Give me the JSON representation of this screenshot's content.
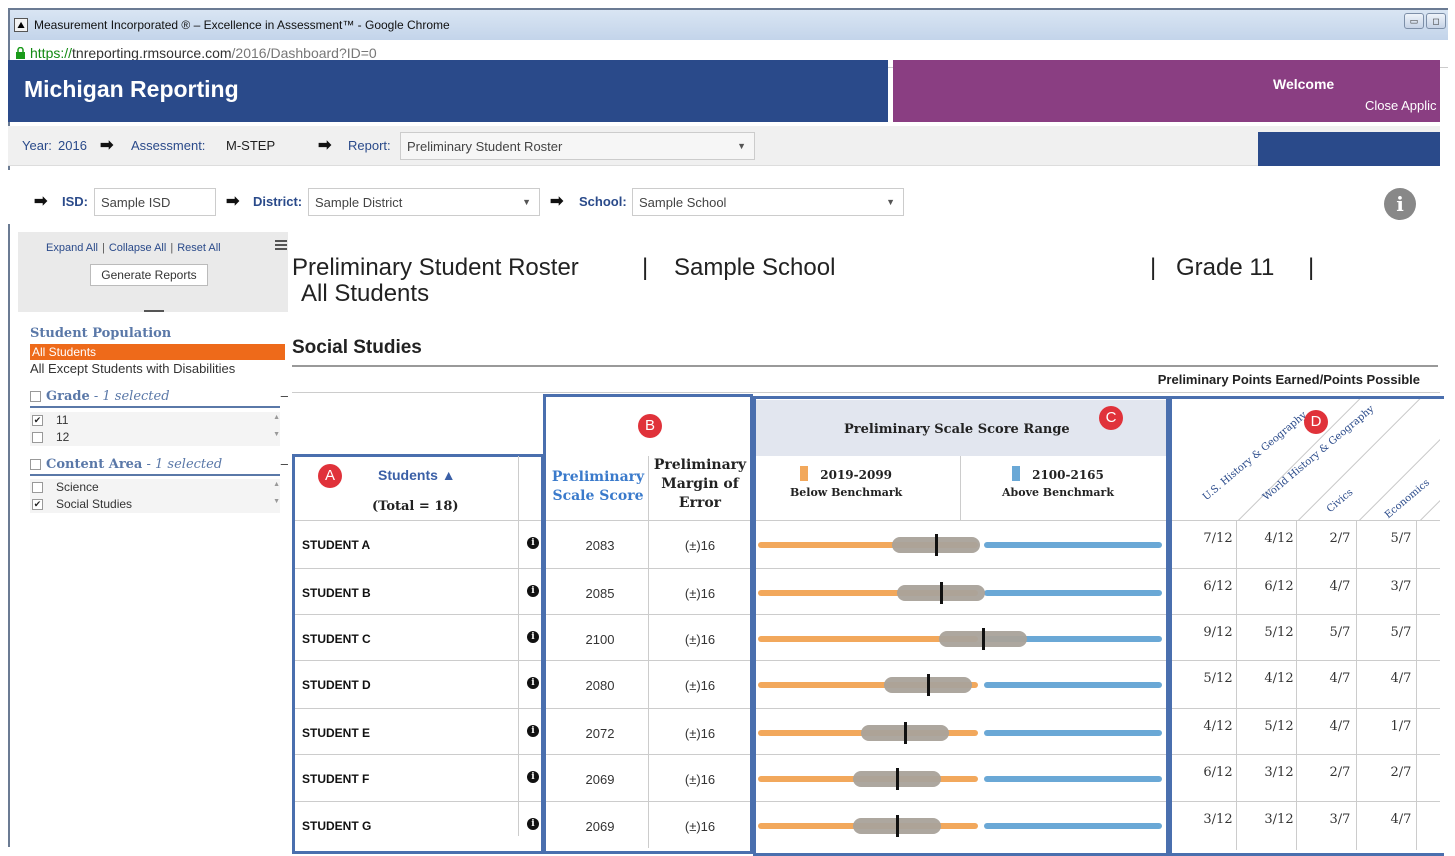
{
  "browser": {
    "window_title": "Measurement Incorporated ® – Excellence in Assessment™ - Google Chrome",
    "url_https": "https://",
    "url_host": "tnreporting.rmsource.com",
    "url_path": "/2016/Dashboard?ID=0"
  },
  "app": {
    "title": "Michigan Reporting",
    "welcome": "Welcome",
    "close_label": "Close Applic"
  },
  "filters": {
    "year_label": "Year:",
    "year_value": "2016",
    "assessment_label": "Assessment:",
    "assessment_value": "M-STEP",
    "report_label": "Report:",
    "report_value": "Preliminary Student Roster",
    "isd_label": "ISD:",
    "isd_value": "Sample ISD",
    "district_label": "District:",
    "district_value": "Sample District",
    "school_label": "School:",
    "school_value": "Sample School"
  },
  "sidebar": {
    "expand_all": "Expand All",
    "collapse_all": "Collapse All",
    "reset_all": "Reset All",
    "generate_reports": "Generate Reports",
    "population_title": "Student Population",
    "population_selected": "All Students",
    "population_other": "All Except Students with Disabilities",
    "grade_title": "Grade",
    "grade_selected": " - 1 selected",
    "grade_options": [
      "11",
      "12"
    ],
    "content_title": "Content Area",
    "content_selected": " - 1 selected",
    "content_options": [
      "Science",
      "Social Studies"
    ]
  },
  "main": {
    "title": "Preliminary Student Roster",
    "separator": "|",
    "school": "Sample School",
    "grade": "Grade 11",
    "population": "All Students",
    "subject": "Social Studies",
    "points_caption": "Preliminary Points Earned/Points Possible",
    "students_label": "Students ▲",
    "total_label": "(Total = 18)",
    "scale_score_label": "Preliminary Scale Score",
    "moe_label": "Preliminary Margin of Error",
    "range_title": "Preliminary Scale Score Range",
    "below_range": "2019-2099",
    "below_label": "Below Benchmark",
    "above_range": "2100-2165",
    "above_label": "Above Benchmark",
    "strand_labels": [
      "U.S. History & Geography",
      "World History & Geography",
      "Civics",
      "Economics"
    ],
    "markers": [
      "A",
      "B",
      "C",
      "D"
    ]
  },
  "colors": {
    "header_blue": "#2a4a8a",
    "welcome_purple": "#8a3e82",
    "selected_orange": "#ee6a1a",
    "below_orange": "#f2a85c",
    "above_blue": "#6aa8d6",
    "marker_red": "#e0323a"
  },
  "students": [
    {
      "name": "STUDENT A",
      "score": 2083,
      "score_label": "2083",
      "moe": "(±)16",
      "points": [
        "7/12",
        "4/12",
        "2/7",
        "5/7"
      ]
    },
    {
      "name": "STUDENT B",
      "score": 2085,
      "score_label": "2085",
      "moe": "(±)16",
      "points": [
        "6/12",
        "6/12",
        "4/7",
        "3/7"
      ]
    },
    {
      "name": "STUDENT C",
      "score": 2100,
      "score_label": "2100",
      "moe": "(±)16",
      "points": [
        "9/12",
        "5/12",
        "5/7",
        "5/7"
      ]
    },
    {
      "name": "STUDENT D",
      "score": 2080,
      "score_label": "2080",
      "moe": "(±)16",
      "points": [
        "5/12",
        "4/12",
        "4/7",
        "4/7"
      ]
    },
    {
      "name": "STUDENT E",
      "score": 2072,
      "score_label": "2072",
      "moe": "(±)16",
      "points": [
        "4/12",
        "5/12",
        "4/7",
        "1/7"
      ]
    },
    {
      "name": "STUDENT F",
      "score": 2069,
      "score_label": "2069",
      "moe": "(±)16",
      "points": [
        "6/12",
        "3/12",
        "2/7",
        "2/7"
      ]
    },
    {
      "name": "STUDENT G",
      "score": 2069,
      "score_label": "2069",
      "moe": "(±)16",
      "points": [
        "3/12",
        "3/12",
        "3/7",
        "4/7"
      ]
    }
  ]
}
